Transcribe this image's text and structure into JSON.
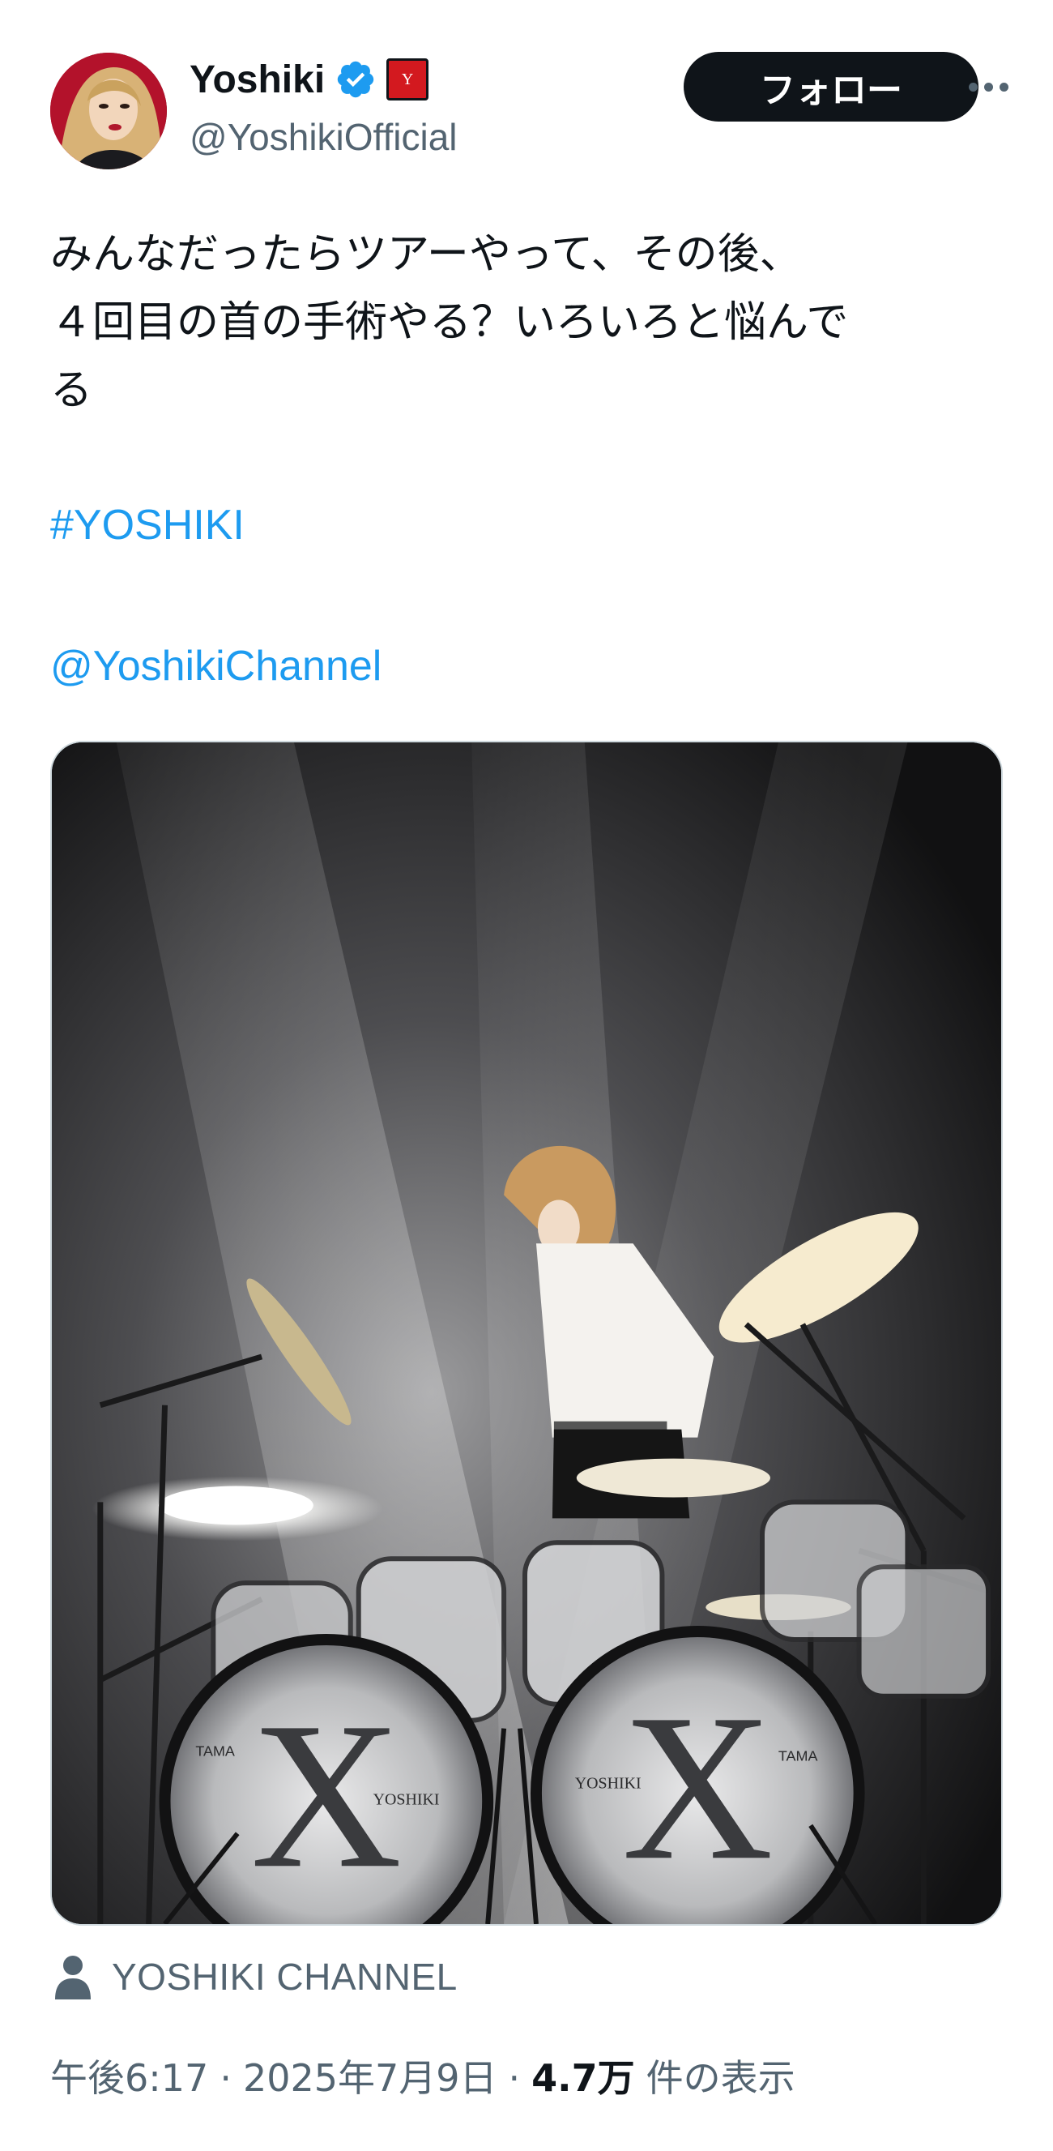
{
  "header": {
    "display_name": "Yoshiki",
    "handle": "@YoshikiOfficial",
    "follow_label": "フォロー",
    "verified_badge_icon": "verified-badge-icon",
    "affiliate_badge_icon": "affiliate-badge-icon",
    "affiliate_badge_text": "Y",
    "more_icon": "more-horizontal-icon"
  },
  "tweet": {
    "lines": [
      "みんなだったらツアーやって、その後、",
      "４回目の首の手術やる？いろいろと悩んで",
      "る"
    ],
    "hashtag": "#YOSHIKI",
    "mention": "@YoshikiChannel"
  },
  "media": {
    "kind": "photo",
    "icon": "concert-photo",
    "drum_text_left": "YOSHIKI",
    "drum_text_right": "YOSHIKI",
    "drum_brand": "TAMA"
  },
  "source": {
    "icon": "person-icon",
    "label": "YOSHIKI CHANNEL"
  },
  "meta": {
    "time": "午後6:17",
    "separator": "·",
    "date": "2025年7月9日",
    "views_count": "4.7万",
    "views_label": "件の表示"
  },
  "colors": {
    "text": "#0f1419",
    "secondary": "#536471",
    "link": "#1d9bf0",
    "verified": "#1d9bf0",
    "affiliate_badge": "#d3191f"
  }
}
